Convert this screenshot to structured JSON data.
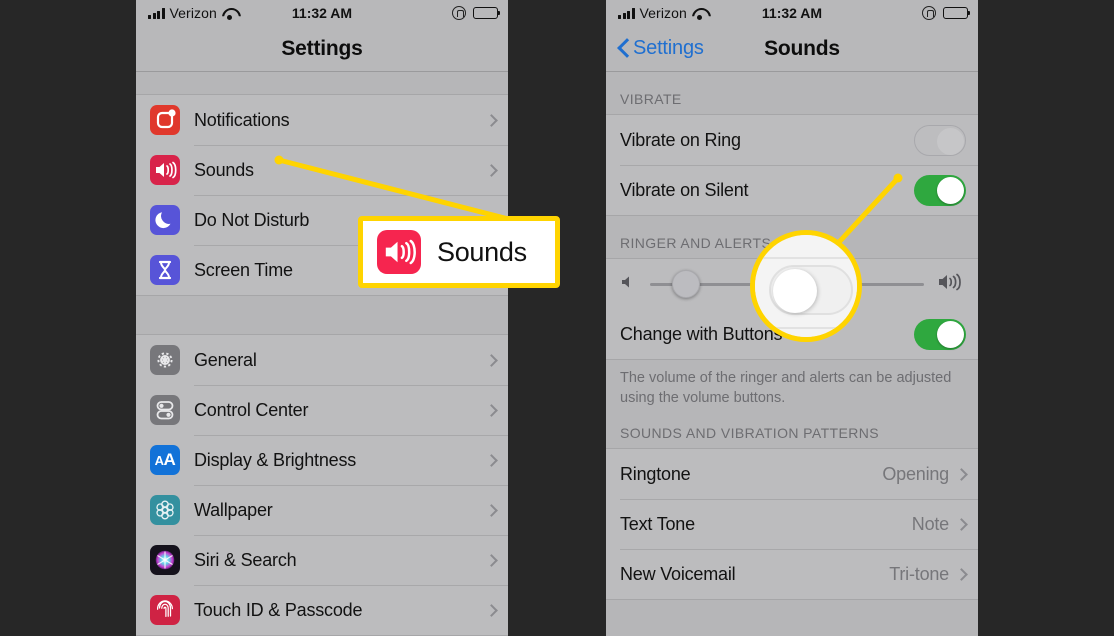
{
  "background_color": "#272727",
  "accent_yellow": "#ffd400",
  "phones": [
    {
      "id": "settings",
      "status_bar": {
        "carrier": "Verizon",
        "time": "11:32 AM",
        "signal_icon": "signal-bars-icon",
        "wifi_icon": "wifi-icon",
        "rotation_lock_icon": "rotation-lock-icon",
        "battery_icon": "battery-icon"
      },
      "nav": {
        "title": "Settings",
        "back_label": null
      },
      "groups": [
        {
          "rows": [
            {
              "label": "Notifications",
              "icon": "notifications-icon",
              "icon_color": "#e0382c",
              "accessory": "chevron-right-icon"
            },
            {
              "label": "Sounds",
              "icon": "sounds-speaker-icon",
              "icon_color": "#d8234a",
              "accessory": "chevron-right-icon"
            },
            {
              "label": "Do Not Disturb",
              "icon": "moon-icon",
              "icon_color": "#5754d8",
              "accessory": "chevron-right-icon"
            },
            {
              "label": "Screen Time",
              "icon": "hourglass-icon",
              "icon_color": "#5754d8",
              "accessory": "chevron-right-icon"
            }
          ]
        },
        {
          "rows": [
            {
              "label": "General",
              "icon": "gear-icon",
              "icon_color": "#77777b",
              "accessory": "chevron-right-icon"
            },
            {
              "label": "Control Center",
              "icon": "toggles-icon",
              "icon_color": "#77777b",
              "accessory": "chevron-right-icon"
            },
            {
              "label": "Display & Brightness",
              "icon": "text-size-icon",
              "icon_color": "#1272d8",
              "accessory": "chevron-right-icon"
            },
            {
              "label": "Wallpaper",
              "icon": "flower-icon",
              "icon_color": "#34909f",
              "accessory": "chevron-right-icon"
            },
            {
              "label": "Siri & Search",
              "icon": "siri-icon",
              "icon_color": "#15121c",
              "accessory": "chevron-right-icon"
            },
            {
              "label": "Touch ID & Passcode",
              "icon": "fingerprint-icon",
              "icon_color": "#cf2344",
              "accessory": "chevron-right-icon"
            }
          ]
        }
      ]
    },
    {
      "id": "sounds",
      "status_bar": {
        "carrier": "Verizon",
        "time": "11:32 AM",
        "signal_icon": "signal-bars-icon",
        "wifi_icon": "wifi-icon",
        "rotation_lock_icon": "rotation-lock-icon",
        "battery_icon": "battery-icon"
      },
      "nav": {
        "title": "Sounds",
        "back_label": "Settings",
        "back_icon": "chevron-left-icon",
        "back_color": "#1f6fd0"
      },
      "sections": [
        {
          "header": "VIBRATE",
          "rows": [
            {
              "label": "Vibrate on Ring",
              "control": "toggle",
              "state": "off"
            },
            {
              "label": "Vibrate on Silent",
              "control": "toggle",
              "state": "on"
            }
          ]
        },
        {
          "header": "RINGER AND ALERTS",
          "rows": [
            {
              "label": "",
              "control": "slider",
              "value_percent": 12,
              "left_icon": "speaker-low-icon",
              "right_icon": "speaker-high-icon"
            },
            {
              "label": "Change with Buttons",
              "control": "toggle",
              "state": "on"
            }
          ],
          "footer": "The volume of the ringer and alerts can be adjusted using the volume buttons."
        },
        {
          "header": "SOUNDS AND VIBRATION PATTERNS",
          "rows": [
            {
              "label": "Ringtone",
              "value": "Opening",
              "accessory": "chevron-right-icon"
            },
            {
              "label": "Text Tone",
              "value": "Note",
              "accessory": "chevron-right-icon"
            },
            {
              "label": "New Voicemail",
              "value": "Tri-tone",
              "accessory": "chevron-right-icon"
            }
          ]
        }
      ]
    }
  ],
  "annotations": {
    "callout": {
      "label": "Sounds",
      "icon": "sounds-speaker-icon",
      "icon_color": "#f6254f",
      "border_color": "#ffd400"
    },
    "magnifier": {
      "depicts": "vibrate-on-ring-toggle-off",
      "border_color": "#ffd400"
    },
    "pointer_lines": [
      {
        "from": "sounds-row-label",
        "to": "callout"
      },
      {
        "from": "vibrate-on-ring-toggle",
        "to": "magnifier"
      }
    ]
  }
}
